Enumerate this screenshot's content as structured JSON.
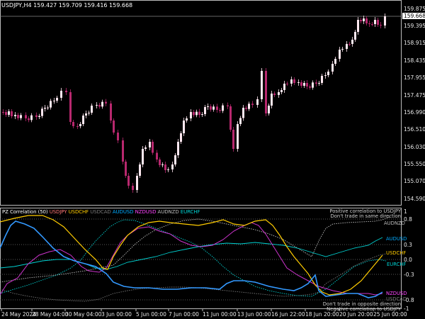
{
  "chart": {
    "symbol_line": "USDJPY,H4  159.427 159.709 159.416 159.668",
    "current_price": "159.668",
    "price_axis": [
      "159.875",
      "159.395",
      "158.915",
      "158.435",
      "157.955",
      "157.475",
      "156.990",
      "156.510",
      "156.030",
      "155.550",
      "155.070",
      "154.590"
    ],
    "date_axis": [
      "24 May 2024",
      "28 May 04:00",
      "30 May 04:00",
      "3 Jun 00:00",
      "5 Jun 00:00",
      "7 Jun 00:00",
      "11 Jun 00:00",
      "13 Jun 00:00",
      "16 Jun 22:00",
      "18 Jun 20:00",
      "20 Jun 20:00",
      "25 Jun 00:00"
    ],
    "colors": {
      "bull": "#ffe8f0",
      "bear": "#b8286e",
      "background": "#000000",
      "axis": "#ffffff"
    }
  },
  "indicator": {
    "header_prefix": "PZ Correlation (50)",
    "series": [
      {
        "name": "USDJPY",
        "color": "#ff7777"
      },
      {
        "name": "USDCHF",
        "color": "#ffcc00"
      },
      {
        "name": "USDCAD",
        "color": "#777777"
      },
      {
        "name": "AUDUSD",
        "color": "#00aaff"
      },
      {
        "name": "NZDUSD",
        "color": "#ff44ff"
      },
      {
        "name": "AUDNZD",
        "color": "#bbbbbb"
      },
      {
        "name": "EURCHF",
        "color": "#00d2d2"
      }
    ],
    "top_note_1": "Positive correlation to USDJPY",
    "top_note_2": "Don't trade in same direction",
    "bottom_note_1": "Don't trade in opposite direction",
    "bottom_note_2": "Negative correlation to USDJPY",
    "levels": [
      "1",
      "0.8",
      "0.3",
      "0.0",
      "-0.3",
      "-0.8",
      "-1"
    ],
    "right_tags": [
      {
        "text": "AUDNZD",
        "color": "#bbbbbb"
      },
      {
        "text": "AUDUSD",
        "color": "#00aaff"
      },
      {
        "text": "USDCHF",
        "color": "#ffcc00"
      },
      {
        "text": "EURCHF",
        "color": "#00d2d2"
      },
      {
        "text": "NZDUSD",
        "color": "#ff44ff"
      },
      {
        "text": "USDCAD",
        "color": "#777777"
      }
    ]
  }
}
